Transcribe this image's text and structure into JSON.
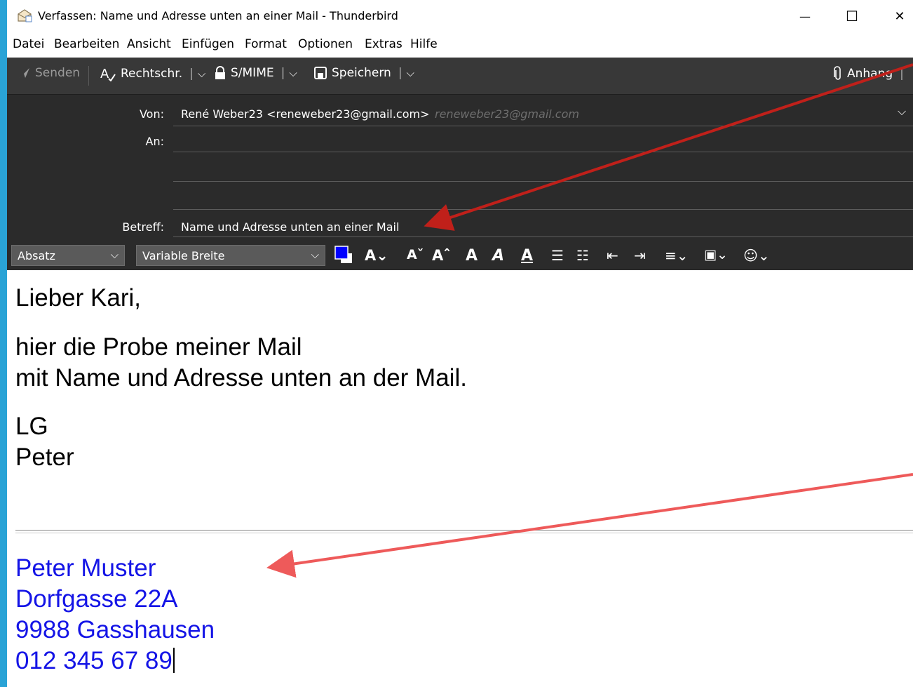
{
  "window": {
    "title": "Verfassen: Name und Adresse unten an einer Mail - Thunderbird",
    "minimize_glyph": "—",
    "maximize_glyph": "☐",
    "close_glyph": "✕"
  },
  "menu": [
    {
      "label": "Datei"
    },
    {
      "label": "Bearbeiten"
    },
    {
      "label": "Ansicht"
    },
    {
      "label": "Einfügen"
    },
    {
      "label": "Format"
    },
    {
      "label": "Optionen"
    },
    {
      "label": "Extras"
    },
    {
      "label": "Hilfe"
    }
  ],
  "toolbar": {
    "send_label": "Senden",
    "spell_label": "Rechtschr.",
    "smime_label": "S/MIME",
    "save_label": "Speichern",
    "attach_label": "Anhang"
  },
  "headers": {
    "from_label": "Von:",
    "from_value": "René Weber23 <reneweber23@gmail.com>",
    "from_hint": "reneweber23@gmail.com",
    "to_label": "An:",
    "subject_label": "Betreff:",
    "subject_value": "Name und Adresse unten an einer Mail"
  },
  "format": {
    "paragraph_select": "Absatz",
    "font_select": "Variable Breite",
    "text_color": "#0000ff"
  },
  "message": {
    "greeting": "Lieber Kari,",
    "line1": "hier die Probe meiner Mail",
    "line2": "mit Name und Adresse unten an der Mail.",
    "closing1": "LG",
    "closing2": "Peter"
  },
  "signature": {
    "name": "Peter Muster",
    "street": "Dorfgasse 22A",
    "city": "9988 Gasshausen",
    "phone": "012 345 67 89",
    "color": "#1414e6"
  }
}
